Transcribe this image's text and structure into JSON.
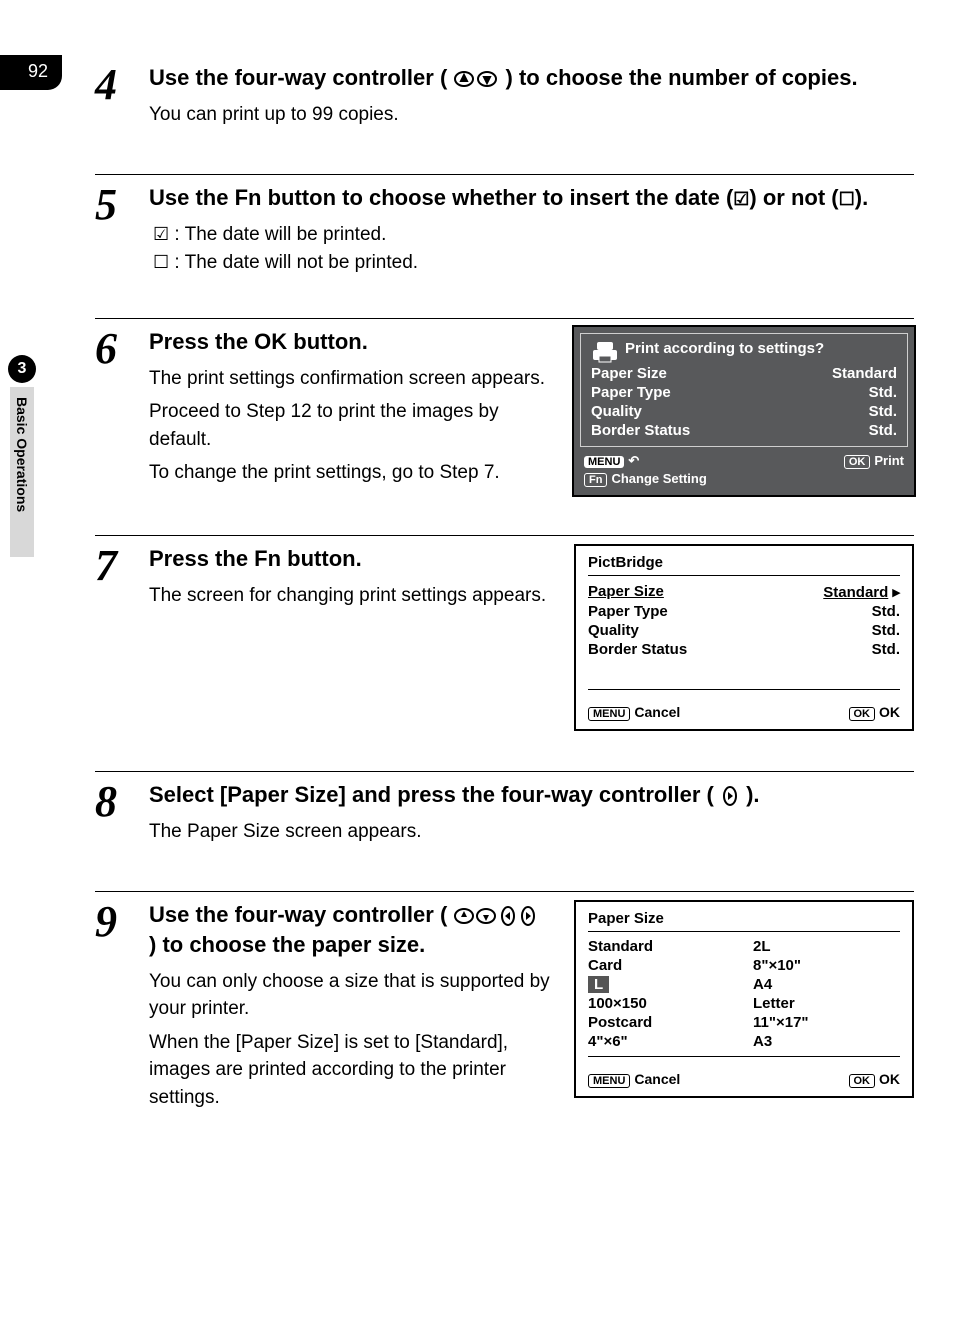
{
  "page_number": "92",
  "sidebar": {
    "section_number": "3",
    "section_label": "Basic Operations"
  },
  "step4": {
    "number": "4",
    "heading_a": "Use the four-way controller (",
    "heading_b": ") to choose the number of copies.",
    "body": "You can print up to 99 copies."
  },
  "step5": {
    "number": "5",
    "heading_a": "Use the ",
    "fn": "Fn",
    "heading_b": " button to choose whether to insert the date (",
    "heading_c": ") or not (",
    "heading_d": ").",
    "row_checked": " : The date will be printed.",
    "row_unchecked": " : The date will not be printed."
  },
  "step6": {
    "number": "6",
    "heading_a": "Press the ",
    "ok": "OK",
    "heading_b": " button.",
    "body1": "The print settings confirmation screen appears.",
    "body2": "Proceed to Step 12 to print the images by default.",
    "body3": "To change the print settings, go to Step 7.",
    "screen": {
      "title": "Print according to settings?",
      "rows": [
        {
          "label": "Paper Size",
          "value": "Standard"
        },
        {
          "label": "Paper Type",
          "value": "Std."
        },
        {
          "label": "Quality",
          "value": "Std."
        },
        {
          "label": "Border Status",
          "value": "Std."
        }
      ],
      "menu": "MENU",
      "fn": "Fn",
      "change": "Change Setting",
      "ok": "OK",
      "print": "Print"
    }
  },
  "step7": {
    "number": "7",
    "heading_a": "Press the ",
    "fn": "Fn",
    "heading_b": " button.",
    "body": "The screen for changing print settings appears.",
    "screen": {
      "title": "PictBridge",
      "rows": [
        {
          "label": "Paper Size",
          "value": "Standard",
          "underlined": true
        },
        {
          "label": "Paper Type",
          "value": "Std."
        },
        {
          "label": "Quality",
          "value": "Std."
        },
        {
          "label": "Border Status",
          "value": "Std."
        }
      ],
      "menu": "MENU",
      "cancel": "Cancel",
      "ok": "OK",
      "ok2": "OK"
    }
  },
  "step8": {
    "number": "8",
    "heading_a": "Select [Paper Size] and press the four-way controller (",
    "heading_b": ").",
    "body": "The Paper Size screen appears."
  },
  "step9": {
    "number": "9",
    "heading_a": "Use the four-way controller (",
    "heading_b": ") to choose the paper size.",
    "body1": "You can only choose a size that is supported by your printer.",
    "body2": "When the [Paper Size] is set to [Standard], images are printed according to the printer settings.",
    "screen": {
      "title": "Paper Size",
      "left_col": [
        "Standard",
        "Card",
        "L",
        "100×150",
        "Postcard",
        "4\"×6\""
      ],
      "right_col": [
        "2L",
        "8\"×10\"",
        "A4",
        "Letter",
        "11\"×17\"",
        "A3"
      ],
      "selected": "L",
      "menu": "MENU",
      "cancel": "Cancel",
      "ok": "OK",
      "ok2": "OK"
    }
  }
}
